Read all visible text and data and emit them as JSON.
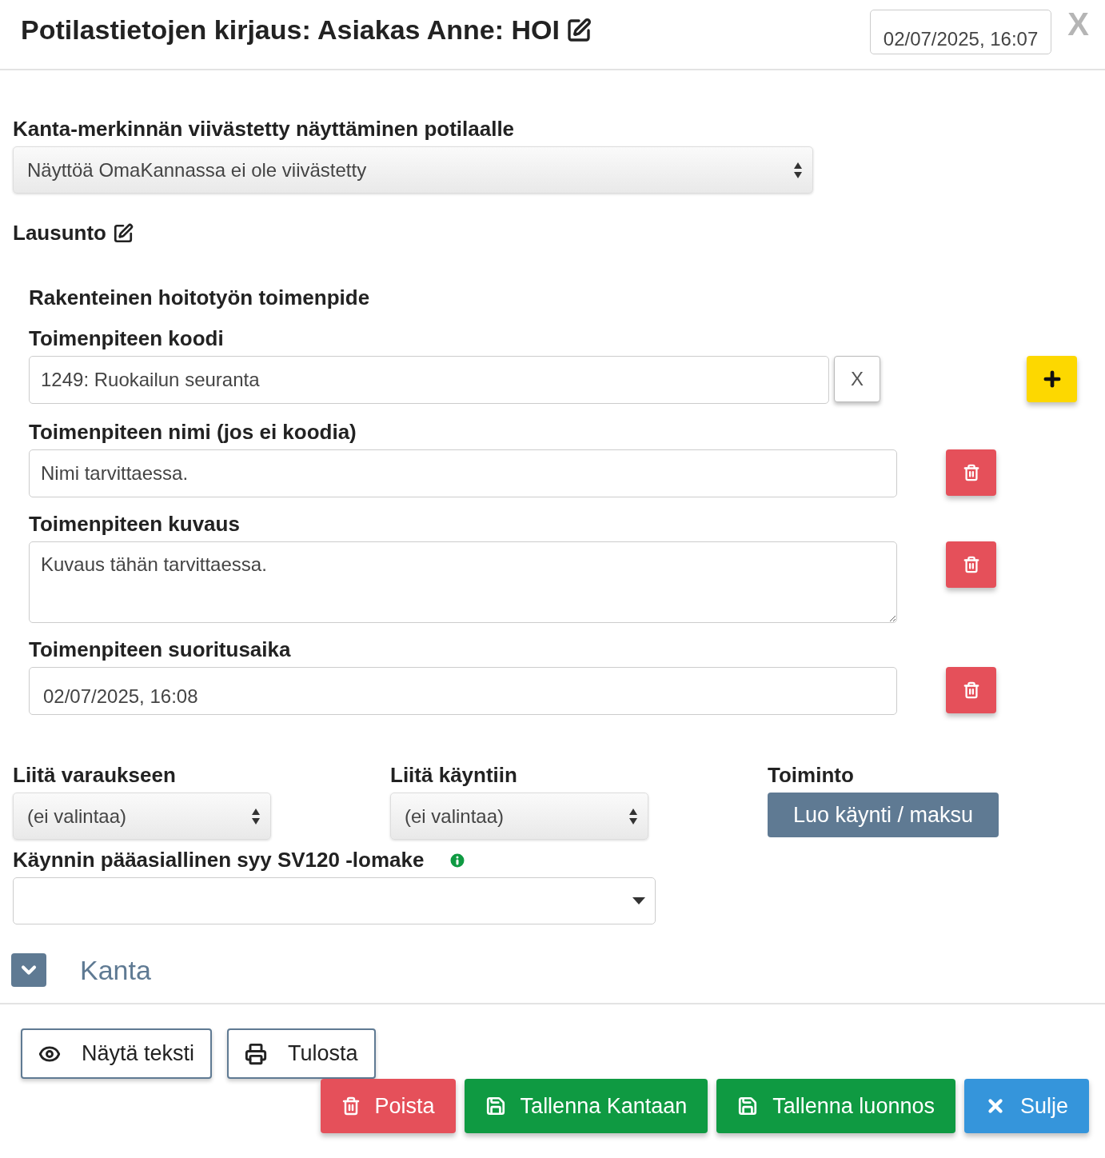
{
  "header": {
    "title": "Potilastietojen kirjaus: Asiakas Anne: HOI",
    "datetime": "02/07/2025, 16:07",
    "close": "X"
  },
  "delay": {
    "label": "Kanta-merkinnän viivästetty näyttäminen potilaalle",
    "value": "Näyttöä OmaKannassa ei ole viivästetty"
  },
  "statement": {
    "label": "Lausunto"
  },
  "procedure": {
    "heading": "Rakenteinen hoitotyön toimenpide",
    "code": {
      "label": "Toimenpiteen koodi",
      "value": "1249: Ruokailun seuranta",
      "clear": "X"
    },
    "name": {
      "label": "Toimenpiteen nimi (jos ei koodia)",
      "placeholder": "Nimi tarvittaessa."
    },
    "description": {
      "label": "Toimenpiteen kuvaus",
      "placeholder": "Kuvaus tähän tarvittaessa."
    },
    "time": {
      "label": "Toimenpiteen suoritusaika",
      "value": "02/07/2025, 16:08"
    }
  },
  "links": [
    {
      "label": "Liitä varaukseen",
      "value": "(ei valintaa)"
    },
    {
      "label": "Liitä käyntiin",
      "value": "(ei valintaa)"
    }
  ],
  "action": {
    "label": "Toiminto",
    "button": "Luo käynti / maksu"
  },
  "reason": {
    "label": "Käynnin pääasiallinen syy SV120 -lomake"
  },
  "kanta": {
    "label": "Kanta",
    "expanded": false
  },
  "footer": {
    "left": [
      {
        "kind": "view",
        "label": "Näytä teksti"
      },
      {
        "kind": "print",
        "label": "Tulosta"
      }
    ],
    "right": [
      {
        "kind": "delete",
        "label": "Poista"
      },
      {
        "kind": "save",
        "label": "Tallenna Kantaan"
      },
      {
        "kind": "save",
        "label": "Tallenna luonnos"
      },
      {
        "kind": "close",
        "label": "Sulje"
      }
    ]
  }
}
